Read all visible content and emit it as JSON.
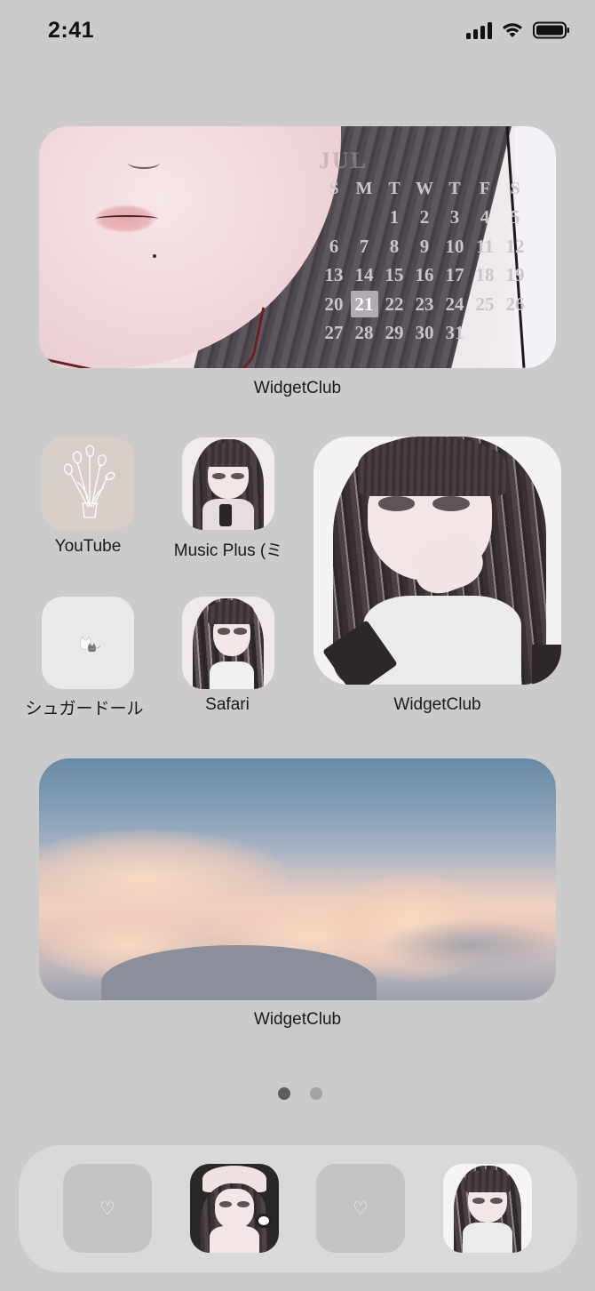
{
  "status_bar": {
    "time": "2:41",
    "icons": [
      "cellular-signal-icon",
      "wifi-icon",
      "battery-icon"
    ]
  },
  "calendar_widget": {
    "label": "WidgetClub",
    "month": "JUL",
    "weekday_headers": [
      "S",
      "M",
      "T",
      "W",
      "T",
      "F",
      "S"
    ],
    "weeks": [
      [
        "",
        "",
        "1",
        "2",
        "3",
        "4",
        "5"
      ],
      [
        "6",
        "7",
        "8",
        "9",
        "10",
        "11",
        "12"
      ],
      [
        "13",
        "14",
        "15",
        "16",
        "17",
        "18",
        "19"
      ],
      [
        "20",
        "21",
        "22",
        "23",
        "24",
        "25",
        "26"
      ],
      [
        "27",
        "28",
        "29",
        "30",
        "31",
        "",
        ""
      ]
    ],
    "today": "21"
  },
  "apps": [
    {
      "label": "YouTube",
      "icon": "tulip-bouquet-icon"
    },
    {
      "label": "Music Plus (ミ",
      "icon": "anime-girl-phone-icon"
    },
    {
      "label": "シュガードール",
      "icon": "cat-icon"
    },
    {
      "label": "Safari",
      "icon": "anime-girl-icon"
    }
  ],
  "photo_widget": {
    "label": "WidgetClub"
  },
  "sky_widget": {
    "label": "WidgetClub"
  },
  "page_indicator": {
    "pages": 2,
    "current": 1
  },
  "dock": {
    "apps": [
      {
        "icon": "heart-icon",
        "glyph": "♡"
      },
      {
        "icon": "anime-girl-hat-icon"
      },
      {
        "icon": "heart-icon",
        "glyph": "♡"
      },
      {
        "icon": "anime-girl-peace-icon"
      }
    ]
  },
  "colors": {
    "wallpaper": "#cbcbcb",
    "dock": "#d9d9d9",
    "calendar_today": "#b0acb1"
  }
}
